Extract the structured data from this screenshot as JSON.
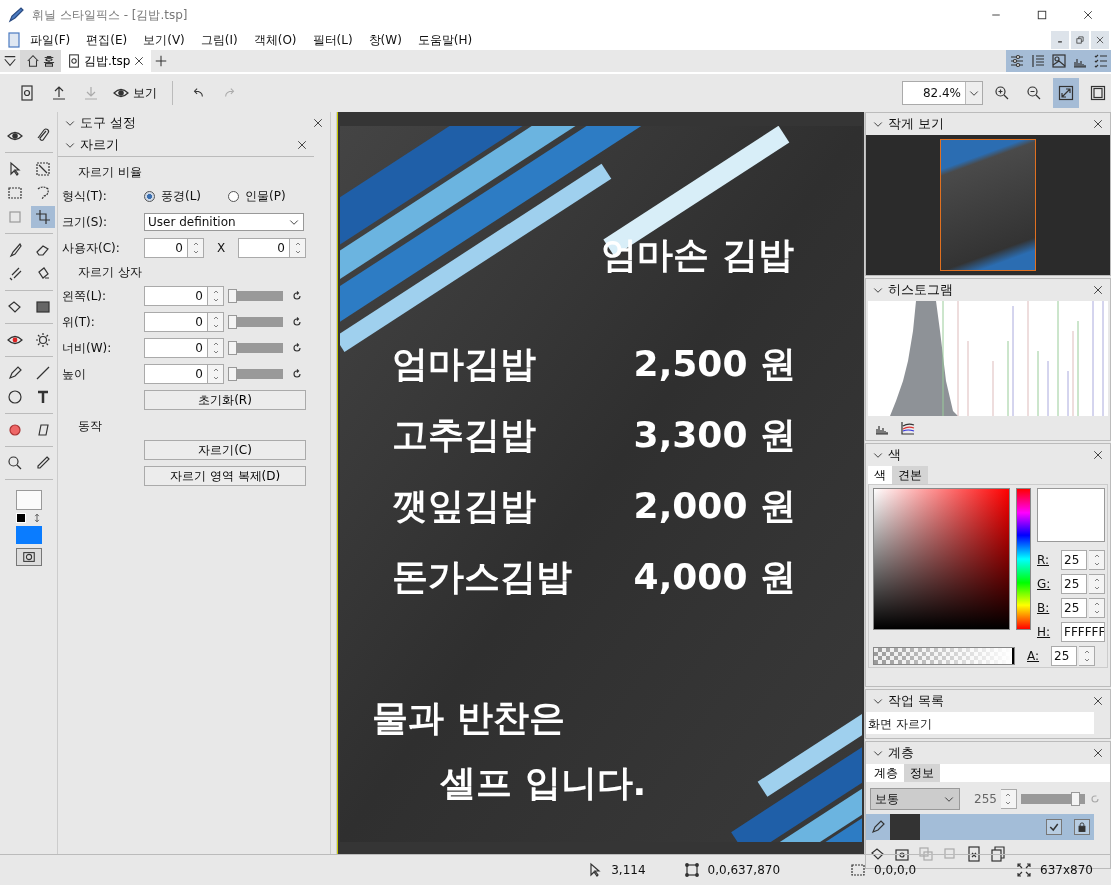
{
  "window": {
    "title": "휘닐 스타일픽스 - [김밥.tsp]"
  },
  "menu": [
    "파일(F)",
    "편집(E)",
    "보기(V)",
    "그림(I)",
    "객체(O)",
    "필터(L)",
    "창(W)",
    "도움말(H)"
  ],
  "tabs": [
    {
      "label": "홈",
      "kind": "home",
      "selected": false
    },
    {
      "label": "김밥.tsp",
      "kind": "document",
      "selected": true
    }
  ],
  "panel_toggles": [
    {
      "kind": "sliders",
      "on": true
    },
    {
      "kind": "list",
      "on": true
    },
    {
      "kind": "image",
      "on": true
    },
    {
      "kind": "histogram",
      "on": true
    },
    {
      "kind": "checklist",
      "on": true
    }
  ],
  "toolbar": {
    "view_label": "보기",
    "zoom": "82.4%",
    "fit_selected": true,
    "actual_selected": false
  },
  "tool_groups": [
    [
      {
        "kind": "eye",
        "selected": false
      },
      {
        "kind": "paperclip",
        "selected": false
      }
    ],
    [
      {
        "kind": "pointer",
        "selected": false
      },
      {
        "kind": "dotted-square",
        "selected": false
      },
      {
        "kind": "selection",
        "selected": false
      },
      {
        "kind": "lasso",
        "selected": false
      },
      {
        "kind": "frame",
        "selected": false
      },
      {
        "kind": "crop",
        "selected": true
      }
    ],
    [
      {
        "kind": "brush",
        "selected": false
      },
      {
        "kind": "eraser",
        "selected": false
      },
      {
        "kind": "clone",
        "selected": false
      },
      {
        "kind": "bucket",
        "selected": false
      }
    ],
    [
      {
        "kind": "fill",
        "selected": false
      },
      {
        "kind": "pattern",
        "selected": false
      }
    ],
    [
      {
        "kind": "eye-retouch",
        "selected": false
      },
      {
        "kind": "sun",
        "selected": false
      }
    ],
    [
      {
        "kind": "pen",
        "selected": false
      },
      {
        "kind": "line",
        "selected": false
      },
      {
        "kind": "circle",
        "selected": false
      },
      {
        "kind": "text",
        "selected": false
      }
    ],
    [
      {
        "kind": "bandage",
        "selected": false
      },
      {
        "kind": "stamp",
        "selected": false
      }
    ],
    [
      {
        "kind": "zoom",
        "selected": false
      },
      {
        "kind": "eyedropper",
        "selected": false
      }
    ]
  ],
  "tool_settings": {
    "title": "도구 설정",
    "section": "자르기",
    "ratio_heading": "자르기 비율",
    "format_label": "형식(T):",
    "format_options": [
      {
        "label": "풍경(L)",
        "selected": true
      },
      {
        "label": "인물(P)",
        "selected": false
      }
    ],
    "size_label": "크기(S):",
    "size_value": "User definition",
    "custom_label": "사용자(C):",
    "custom_w": "0",
    "x_label": "X",
    "custom_h": "0",
    "box_heading": "자르기 상자",
    "box_fields": [
      {
        "label": "왼쪽(L):",
        "value": "0",
        "level": 0
      },
      {
        "label": "위(T):",
        "value": "0",
        "level": 0
      },
      {
        "label": "너비(W):",
        "value": "0",
        "level": 0
      },
      {
        "label": "높이",
        "value": "0",
        "level": 0
      }
    ],
    "reset_button": "초기화(R)",
    "action_heading": "동작",
    "buttons": [
      "자르기(C)",
      "자르기 영역 복제(D)"
    ]
  },
  "document": {
    "title": "엄마손 김밥",
    "items": [
      {
        "name": "엄마김밥",
        "price": "2,500 원"
      },
      {
        "name": "고추김밥",
        "price": "3,300 원"
      },
      {
        "name": "깻잎김밥",
        "price": "2,000 원"
      },
      {
        "name": "돈가스김밥",
        "price": "4,000 원"
      }
    ],
    "footer": [
      "물과 반찬은",
      "셀프 입니다."
    ]
  },
  "navigator": {
    "title": "작게 보기"
  },
  "histogram": {
    "title": "히스토그램"
  },
  "color": {
    "title": "색",
    "alpha": {
      "level": 1
    },
    "tabs": [
      {
        "label": "색",
        "selected": true
      },
      {
        "label": "견본",
        "selected": false
      }
    ],
    "channels": [
      {
        "label": "R:",
        "value": "25",
        "kind": "spin"
      },
      {
        "label": "G:",
        "value": "25",
        "kind": "spin"
      },
      {
        "label": "B:",
        "value": "25",
        "kind": "spin"
      },
      {
        "label": "H:",
        "value": "FFFFFF",
        "kind": "hex"
      },
      {
        "label": "A:",
        "value": "25",
        "kind": "spin"
      }
    ]
  },
  "history": {
    "title": "작업 목록",
    "items": [
      "화면 자르기"
    ]
  },
  "layers": {
    "title": "계층",
    "tabs": [
      {
        "label": "계층",
        "selected": true
      },
      {
        "label": "정보",
        "selected": false
      }
    ],
    "blend": "보통",
    "opacity": "255",
    "level": 1,
    "layer": {
      "visible": true,
      "locked": true
    }
  },
  "status": {
    "cursor": "3,114",
    "canvas": "0,0,637,870",
    "selection": "0,0,0,0",
    "size": "637x870"
  }
}
